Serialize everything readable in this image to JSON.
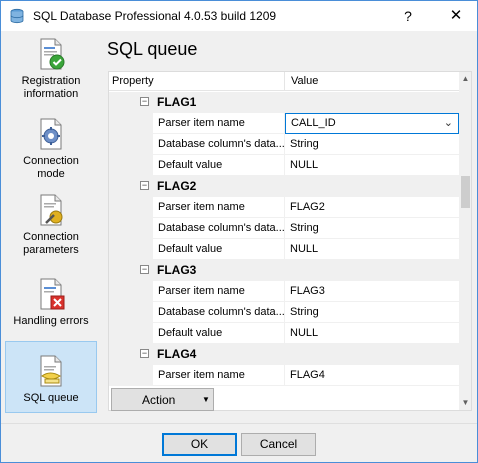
{
  "window": {
    "title": "SQL Database Professional 4.0.53 build 1209",
    "help_glyph": "?",
    "close_glyph": "✕"
  },
  "sidebar": {
    "items": [
      {
        "label_line1": "Registration",
        "label_line2": "information",
        "icon": "registration-checkmark-icon"
      },
      {
        "label_line1": "Connection",
        "label_line2": "mode",
        "icon": "connection-gear-icon"
      },
      {
        "label_line1": "Connection",
        "label_line2": "parameters",
        "icon": "connection-parameters-icon"
      },
      {
        "label_line1": "Handling errors",
        "label_line2": "",
        "icon": "error-document-icon"
      },
      {
        "label_line1": "SQL queue",
        "label_line2": "",
        "icon": "sql-queue-icon"
      }
    ],
    "active_index": 4
  },
  "main": {
    "title": "SQL queue",
    "grid": {
      "headers": {
        "property": "Property",
        "value": "Value"
      },
      "categories": [
        {
          "name": "FLAG1",
          "collapse_glyph": "−",
          "rows": [
            {
              "name": "Parser item name",
              "value": "CALL_ID"
            },
            {
              "name": "Database column's data...",
              "value": "String"
            },
            {
              "name": "Default value",
              "value": "NULL"
            }
          ]
        },
        {
          "name": "FLAG2",
          "collapse_glyph": "−",
          "rows": [
            {
              "name": "Parser item name",
              "value": "FLAG2"
            },
            {
              "name": "Database column's data...",
              "value": "String"
            },
            {
              "name": "Default value",
              "value": "NULL"
            }
          ]
        },
        {
          "name": "FLAG3",
          "collapse_glyph": "−",
          "rows": [
            {
              "name": "Parser item name",
              "value": "FLAG3"
            },
            {
              "name": "Database column's data...",
              "value": "String"
            },
            {
              "name": "Default value",
              "value": "NULL"
            }
          ]
        },
        {
          "name": "FLAG4",
          "collapse_glyph": "−",
          "rows": [
            {
              "name": "Parser item name",
              "value": "FLAG4"
            }
          ]
        }
      ],
      "scroll_up_glyph": "▲",
      "scroll_down_glyph": "▼",
      "combo_chevron": "⌄"
    },
    "action_button": {
      "label": "Action",
      "arrow": "▼"
    }
  },
  "footer": {
    "ok_label": "OK",
    "cancel_label": "Cancel"
  },
  "colors": {
    "accent": "#0078d7",
    "active_nav_bg": "#cce4f7",
    "window_border": "#4a8ed8"
  }
}
